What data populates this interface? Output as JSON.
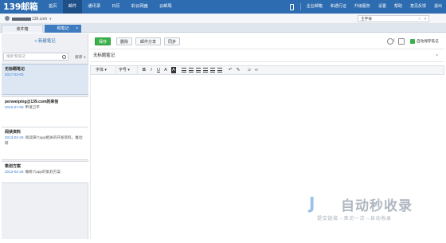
{
  "topnav": {
    "logo": "139邮箱",
    "links": [
      {
        "label": "首页",
        "active": false
      },
      {
        "label": "邮件",
        "active": true
      },
      {
        "label": "通讯录",
        "active": false
      },
      {
        "label": "日历",
        "active": false
      },
      {
        "label": "彩云网盘",
        "active": false
      },
      {
        "label": "云邮局",
        "active": false
      }
    ],
    "right_links": [
      "企业邮箱",
      "和通行证",
      "升级服务",
      "设置",
      "帮助",
      "意见反馈",
      "退出"
    ]
  },
  "account": {
    "email_suffix": "139.com",
    "search_value": "王宇祥"
  },
  "tabs": {
    "inbox": "收件箱",
    "notes": "和笔记"
  },
  "sidebar": {
    "new_note": "+ 新建笔记",
    "search_placeholder": "搜索'和笔记'",
    "sort_label": "排序"
  },
  "notes": [
    {
      "title": "无标题笔记",
      "date": "2017-02-05",
      "snippet": ""
    },
    {
      "title": "penweiping@139.com的来信",
      "date": "2016-07-08",
      "snippet": "申请卫平"
    },
    {
      "title": "阅读资料",
      "date": "2013-02-26",
      "snippet": "阅读研六app相关的开发资料。推动研"
    },
    {
      "title": "策划方案",
      "date": "2013-02-26",
      "snippet": "做研六app的策划方案"
    }
  ],
  "toolbar": {
    "save": "保存",
    "delete": "删除",
    "share": "邮件分享",
    "sync": "同步",
    "autosave": "自动保存笔记"
  },
  "editor": {
    "title": "无标题笔记",
    "font_label": "字体",
    "size_label": "字号"
  },
  "watermark": {
    "logo": "J",
    "title": "自动秒收录",
    "subtitle": "提交链接→来访一次→自动收录"
  },
  "colors": {
    "nav_blue": "#2d6cb0",
    "save_green": "#3bb14a",
    "date_blue": "#3a7bd5"
  }
}
